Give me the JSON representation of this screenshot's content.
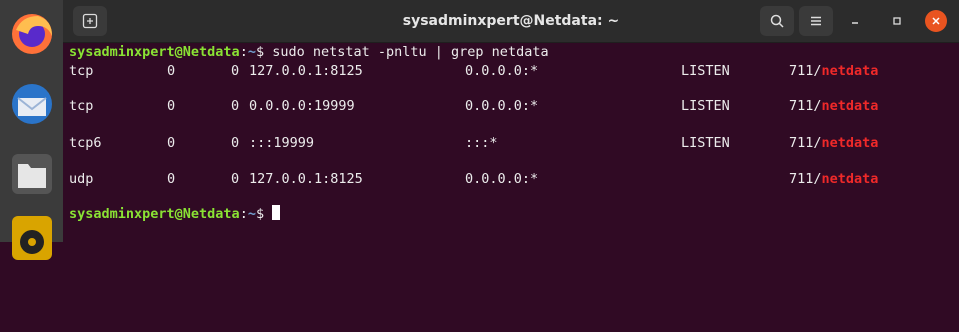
{
  "window": {
    "title": "sysadminxpert@Netdata: ~"
  },
  "dock": {
    "items": [
      {
        "name": "firefox-icon"
      },
      {
        "name": "thunderbird-icon"
      },
      {
        "name": "files-icon"
      },
      {
        "name": "rhythmbox-icon"
      }
    ]
  },
  "terminal": {
    "prompt_user": "sysadminxpert@Netdata",
    "prompt_path": "~",
    "prompt_symbol": "$",
    "command": " sudo netstat -pnltu | grep netdata",
    "rows": [
      {
        "proto": "tcp",
        "recvq": "0",
        "sendq": "0",
        "local": "127.0.0.1:8125",
        "foreign": "0.0.0.0:*",
        "state": "LISTEN",
        "pid": "711/",
        "prog": "netdata"
      },
      {
        "proto": "tcp",
        "recvq": "0",
        "sendq": "0",
        "local": "0.0.0.0:19999",
        "foreign": "0.0.0.0:*",
        "state": "LISTEN",
        "pid": "711/",
        "prog": "netdata"
      },
      {
        "proto": "tcp6",
        "recvq": "0",
        "sendq": "0",
        "local": ":::19999",
        "foreign": ":::*",
        "state": "LISTEN",
        "pid": "711/",
        "prog": "netdata"
      },
      {
        "proto": "udp",
        "recvq": "0",
        "sendq": "0",
        "local": "127.0.0.1:8125",
        "foreign": "0.0.0.0:*",
        "state": "",
        "pid": "711/",
        "prog": "netdata"
      }
    ]
  },
  "colors": {
    "terminal_bg": "#300a24",
    "prompt_user": "#8ae234",
    "prompt_path": "#729fcf",
    "highlight": "#ef2929",
    "close_button": "#e95420"
  }
}
